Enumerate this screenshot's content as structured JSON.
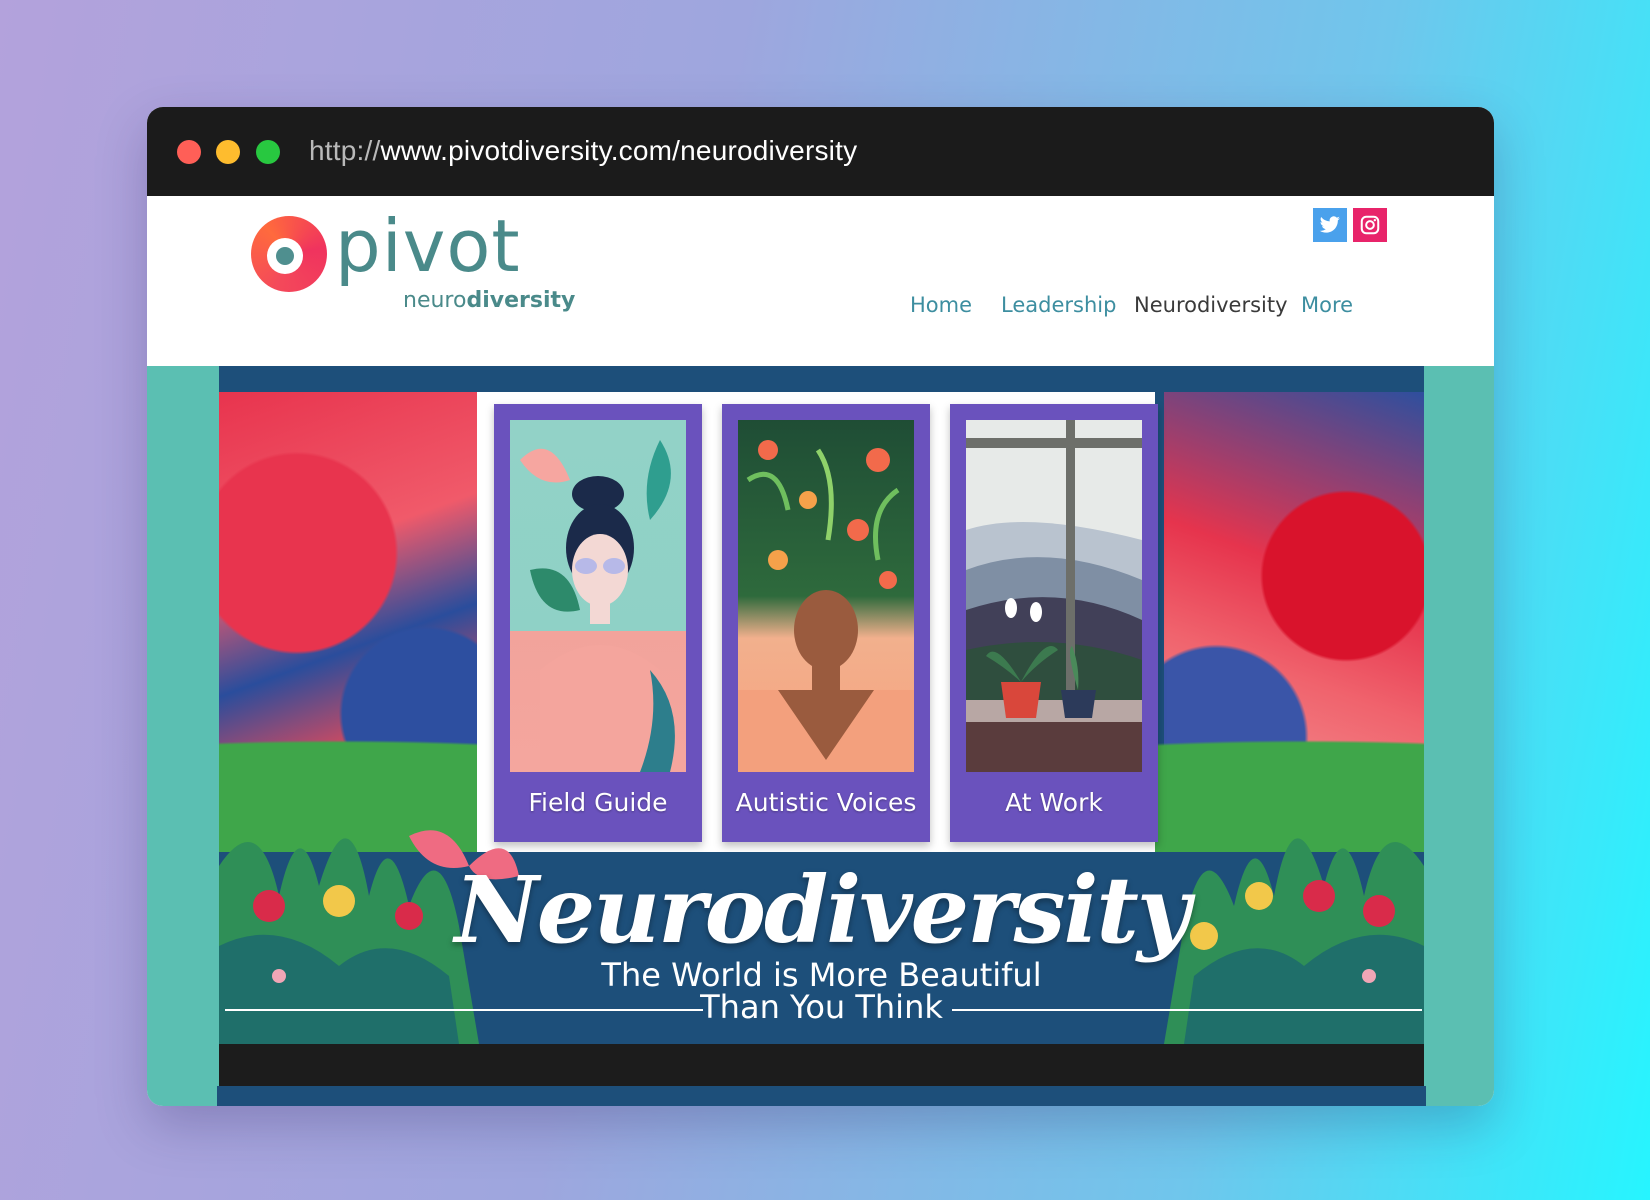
{
  "browser": {
    "url_protocol": "http://",
    "url_rest": "www.pivotdiversity.com/neurodiversity"
  },
  "header": {
    "logo_name": "pivot",
    "logo_sub_light": "neuro",
    "logo_sub_bold": "diversity",
    "social": [
      "twitter-icon",
      "instagram-icon"
    ],
    "nav": [
      {
        "label": "Home"
      },
      {
        "label": "Leadership"
      },
      {
        "label": "Neurodiversity"
      },
      {
        "label": "More"
      }
    ]
  },
  "hero": {
    "cards": [
      {
        "label": "Field Guide"
      },
      {
        "label": "Autistic Voices"
      },
      {
        "label": "At Work"
      }
    ],
    "title": "Neurodiversity",
    "subtitle_line1": "The World is More Beautiful",
    "subtitle_line2": "Than You Think"
  },
  "colors": {
    "accent_teal": "#4a8a8a",
    "nav_link": "#3d8ea0",
    "card_purple": "#6a52bd",
    "hero_navy": "#1d4f7a",
    "side_teal": "#5bbfb2"
  }
}
